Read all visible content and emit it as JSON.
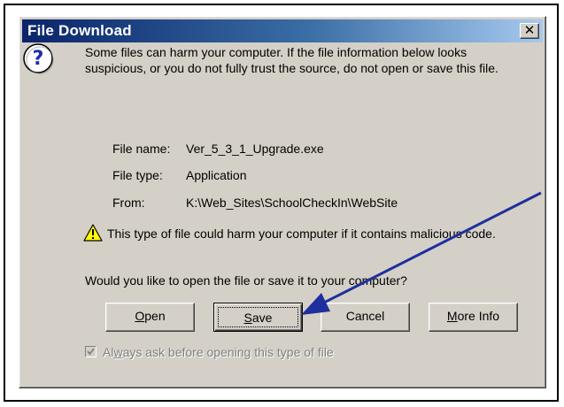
{
  "window": {
    "title": "File Download"
  },
  "message": "Some files can harm your computer. If the file information below looks suspicious, or you do not fully trust the source, do not open or save this file.",
  "file_info": {
    "name_label": "File name:",
    "name_value": "Ver_5_3_1_Upgrade.exe",
    "type_label": "File type:",
    "type_value": "Application",
    "from_label": "From:",
    "from_value": "K:\\Web_Sites\\SchoolCheckIn\\WebSite"
  },
  "warning": "This type of file could harm your computer if it contains malicious code.",
  "question": "Would you like to open the file or save it to your computer?",
  "buttons": {
    "open": {
      "mnemonic": "O",
      "rest": "pen"
    },
    "save": {
      "mnemonic": "S",
      "rest": "ave"
    },
    "cancel": "Cancel",
    "more_info": {
      "mnemonic": "M",
      "rest": "ore Info"
    }
  },
  "checkbox": {
    "label_pre": "Al",
    "label_mnemonic": "w",
    "label_post": "ays ask before opening this type of file",
    "checked": true,
    "enabled": false
  },
  "colors": {
    "title_gradient_start": "#0a246a",
    "title_gradient_end": "#a6caf0",
    "dialog_bg": "#d4d0c8",
    "arrow": "#1f2f9e"
  }
}
